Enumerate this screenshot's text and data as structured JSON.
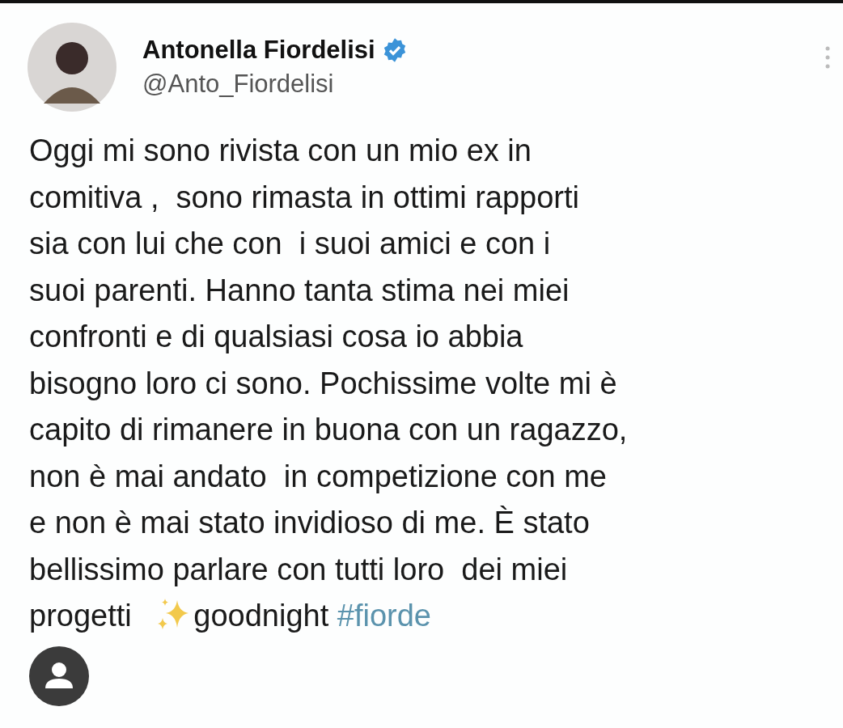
{
  "author": {
    "name": "Antonella Fiordelisi",
    "verified": true,
    "handle": "@Anto_Fiordelisi"
  },
  "body": {
    "lines": [
      "Oggi mi sono rivista con un mio ex in",
      "comitiva ,  sono rimasta in ottimi rapporti",
      "sia con lui che con  i suoi amici e con i",
      "suoi parenti. Hanno tanta stima nei miei",
      "confronti e di qualsiasi cosa io abbia",
      "bisogno loro ci sono. Pochissime volte mi è",
      "capito di rimanere in buona con un ragazzo,",
      "non è mai andato  in competizione con me",
      "e non è mai stato invidioso di me. È stato",
      "bellissimo parlare con tutti loro  dei miei"
    ],
    "last_line": "progetti ",
    "after_sparkles": "goodnight ",
    "hashtag": "#fiorde"
  }
}
